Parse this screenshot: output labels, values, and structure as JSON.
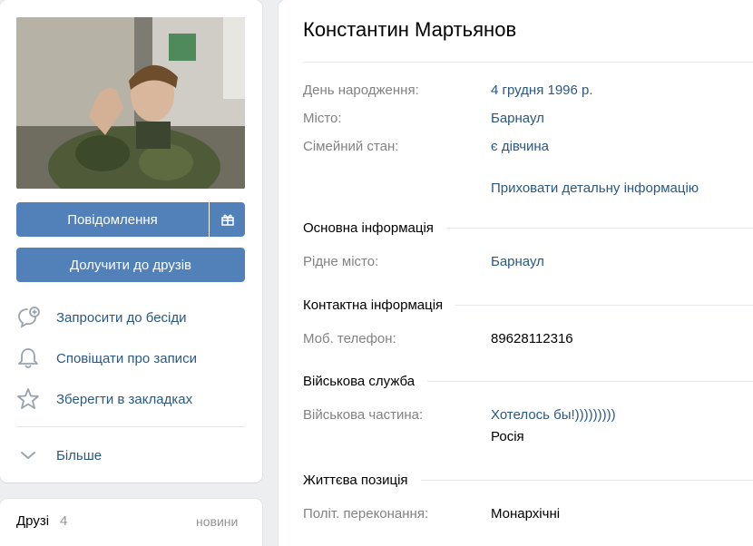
{
  "profile": {
    "name": "Константин Мартьянов",
    "actions": {
      "message": "Повідомлення",
      "add_friend": "Долучити до друзів",
      "invite": "Запросити до бесіди",
      "notify": "Сповіщати про записи",
      "bookmark": "Зберегти в закладках",
      "more": "Більше"
    },
    "friends": {
      "title": "Друзі",
      "count": "4",
      "new_label": "новини"
    }
  },
  "info": {
    "birthday_label": "День народження:",
    "birthday_value": "4 грудня 1996 р.",
    "city_label": "Місто:",
    "city_value": "Барнаул",
    "family_label": "Сімейний стан:",
    "family_value": "є дівчина",
    "hide_details": "Приховати детальну інформацію"
  },
  "sections": {
    "basic": {
      "title": "Основна інформація",
      "hometown_label": "Рідне місто:",
      "hometown_value": "Барнаул"
    },
    "contact": {
      "title": "Контактна інформація",
      "phone_label": "Моб. телефон:",
      "phone_value": "89628112316"
    },
    "military": {
      "title": "Військова служба",
      "unit_label": "Військова частина:",
      "unit_value": "Хотелось бы!)))))))))",
      "unit_country": "Росія"
    },
    "life": {
      "title": "Життєва позиція",
      "politics_label": "Політ. переконання:",
      "politics_value": "Монархічні"
    }
  },
  "colors": {
    "accent": "#5181b8",
    "link": "#2a5885",
    "label": "#828282",
    "background": "#edeef0"
  },
  "icons": [
    "gift-icon",
    "chat-plus-icon",
    "bell-icon",
    "star-icon",
    "chevron-down-icon"
  ]
}
